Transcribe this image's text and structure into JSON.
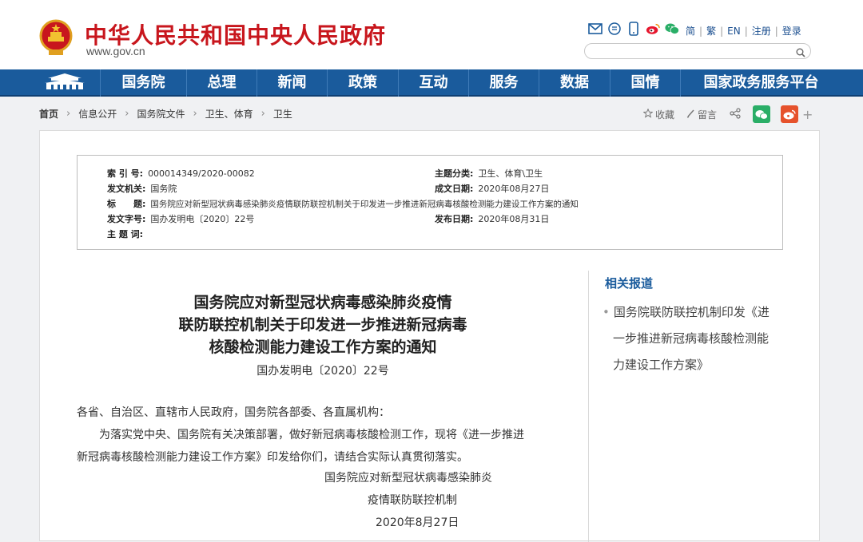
{
  "header": {
    "site_title": "中华人民共和国中央人民政府",
    "site_domain": "www.gov.cn",
    "lang": [
      "简",
      "繁",
      "EN"
    ],
    "register": "注册",
    "login": "登录",
    "search_placeholder": "",
    "icons": [
      "mail-icon",
      "message-icon",
      "phone-icon",
      "weibo-icon",
      "wechat-icon"
    ]
  },
  "nav": {
    "items": [
      "国务院",
      "总理",
      "新闻",
      "政策",
      "互动",
      "服务",
      "数据",
      "国情",
      "国家政务服务平台"
    ]
  },
  "breadcrumb": [
    "首页",
    "信息公开",
    "国务院文件",
    "卫生、体育",
    "卫生"
  ],
  "share": {
    "favorite": "收藏",
    "comment": "留言",
    "more": "+"
  },
  "meta": {
    "index_label": "索 引 号:",
    "index_value": "000014349/2020-00082",
    "category_label": "主题分类:",
    "category_value": "卫生、体育\\卫生",
    "issuer_label": "发文机关:",
    "issuer_value": "国务院",
    "created_label": "成文日期:",
    "created_value": "2020年08月27日",
    "title_label": "标　　题:",
    "title_value": "国务院应对新型冠状病毒感染肺炎疫情联防联控机制关于印发进一步推进新冠病毒核酸检测能力建设工作方案的通知",
    "docno_label": "发文字号:",
    "docno_value": "国办发明电〔2020〕22号",
    "published_label": "发布日期:",
    "published_value": "2020年08月31日",
    "keywords_label": "主 题 词:"
  },
  "document": {
    "title_lines": [
      "国务院应对新型冠状病毒感染肺炎疫情",
      "联防联控机制关于印发进一步推进新冠病毒",
      "核酸检测能力建设工作方案的通知"
    ],
    "doc_number": "国办发明电〔2020〕22号",
    "salutation": "各省、自治区、直辖市人民政府，国务院各部委、各直属机构：",
    "body_line1": "为落实党中央、国务院有关决策部署，做好新冠病毒核酸检测工作，现将《进一步推进",
    "body_line2": "新冠病毒核酸检测能力建设工作方案》印发给你们，请结合实际认真贯彻落实。",
    "sign_line1": "国务院应对新型冠状病毒感染肺炎",
    "sign_line2": "疫情联防联控机制",
    "sign_date": "2020年8月27日"
  },
  "related": {
    "title": "相关报道",
    "lines": [
      "国务院联防联控机制印发《进",
      "一步推进新冠病毒核酸检测能",
      "力建设工作方案》"
    ]
  },
  "colors": {
    "brand_red": "#c8161d",
    "nav_blue": "#1a5b9c",
    "link_blue": "#1a4e8f"
  }
}
